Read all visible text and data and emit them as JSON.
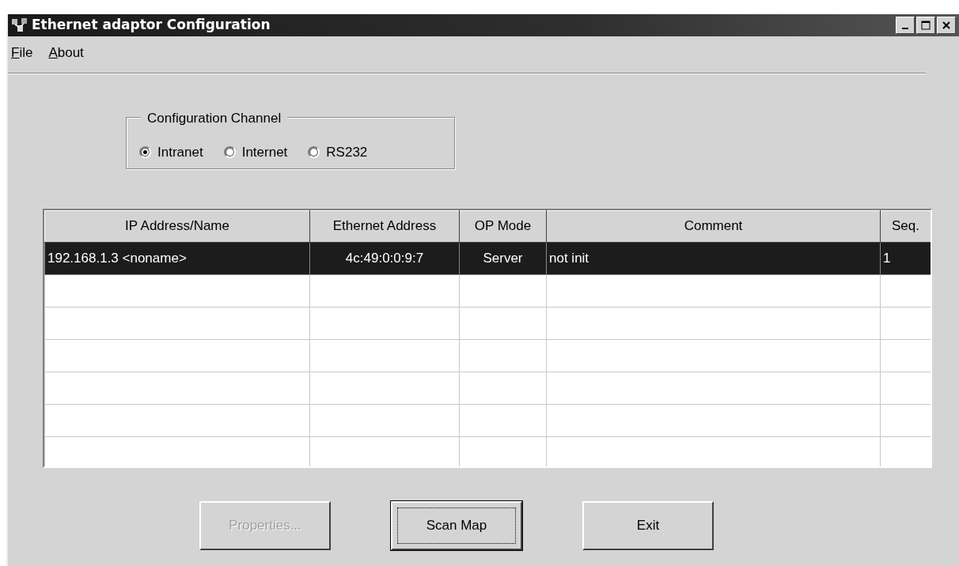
{
  "window": {
    "title": "Ethernet adaptor Configuration"
  },
  "menu": [
    "File",
    "About"
  ],
  "configuration_channel": {
    "label": "Configuration Channel",
    "options": [
      {
        "label": "Intranet",
        "selected": true
      },
      {
        "label": "Internet",
        "selected": false
      },
      {
        "label": "RS232",
        "selected": false
      }
    ]
  },
  "table": {
    "columns": [
      "IP Address/Name",
      "Ethernet Address",
      "OP Mode",
      "Comment",
      "Seq."
    ],
    "rows": [
      {
        "cells": [
          "192.168.1.3 <noname>",
          "4c:49:0:0:9:7",
          "Server",
          "not init",
          "1"
        ],
        "selected": true
      }
    ]
  },
  "buttons": [
    {
      "label": "Properties...",
      "disabled": true,
      "focused": false
    },
    {
      "label": "Scan Map",
      "disabled": false,
      "focused": true
    },
    {
      "label": "Exit",
      "disabled": false,
      "focused": false
    }
  ]
}
